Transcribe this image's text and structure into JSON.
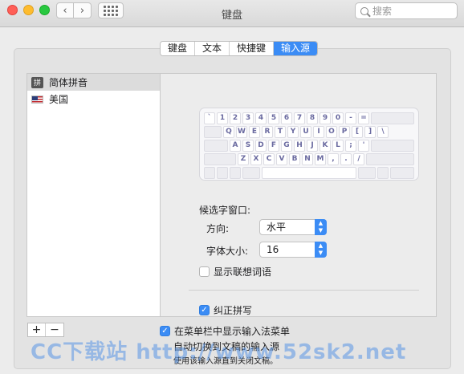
{
  "window": {
    "title": "键盘"
  },
  "search": {
    "placeholder": "搜索"
  },
  "tabs": [
    {
      "label": "键盘",
      "active": false
    },
    {
      "label": "文本",
      "active": false
    },
    {
      "label": "快捷键",
      "active": false
    },
    {
      "label": "输入源",
      "active": true
    }
  ],
  "sources": [
    {
      "icon": "pinyin-badge",
      "badge": "拼",
      "label": "简体拼音",
      "selected": true
    },
    {
      "icon": "us-flag-icon",
      "label": "美国",
      "selected": false
    }
  ],
  "keyboard": {
    "row1": [
      "`",
      "1",
      "2",
      "3",
      "4",
      "5",
      "6",
      "7",
      "8",
      "9",
      "0",
      "-",
      "="
    ],
    "row2": [
      "Q",
      "W",
      "E",
      "R",
      "T",
      "Y",
      "U",
      "I",
      "O",
      "P",
      "[",
      "]",
      "\\"
    ],
    "row3": [
      "A",
      "S",
      "D",
      "F",
      "G",
      "H",
      "J",
      "K",
      "L",
      ";",
      "'"
    ],
    "row4": [
      "Z",
      "X",
      "C",
      "V",
      "B",
      "N",
      "M",
      ",",
      ".",
      "/"
    ]
  },
  "candidate": {
    "heading": "候选字窗口:",
    "direction_label": "方向:",
    "direction_value": "水平",
    "font_size_label": "字体大小:",
    "font_size_value": "16",
    "show_suggestions_label": "显示联想词语",
    "show_suggestions_checked": false,
    "correct_pinyin_label": "纠正拼写",
    "correct_pinyin_checked": true
  },
  "footer": {
    "show_menu_label": "在菜单栏中显示输入法菜单",
    "show_menu_checked": true,
    "auto_switch_label": "自动切换到文稿的输入源",
    "auto_switch_note": "使用该输入源直到关闭文稿。",
    "add_label": "+",
    "remove_label": "−"
  },
  "watermark": {
    "text": "CC下载站 http://www.52sk2.net"
  },
  "colors": {
    "accent": "#3b8cf5"
  }
}
